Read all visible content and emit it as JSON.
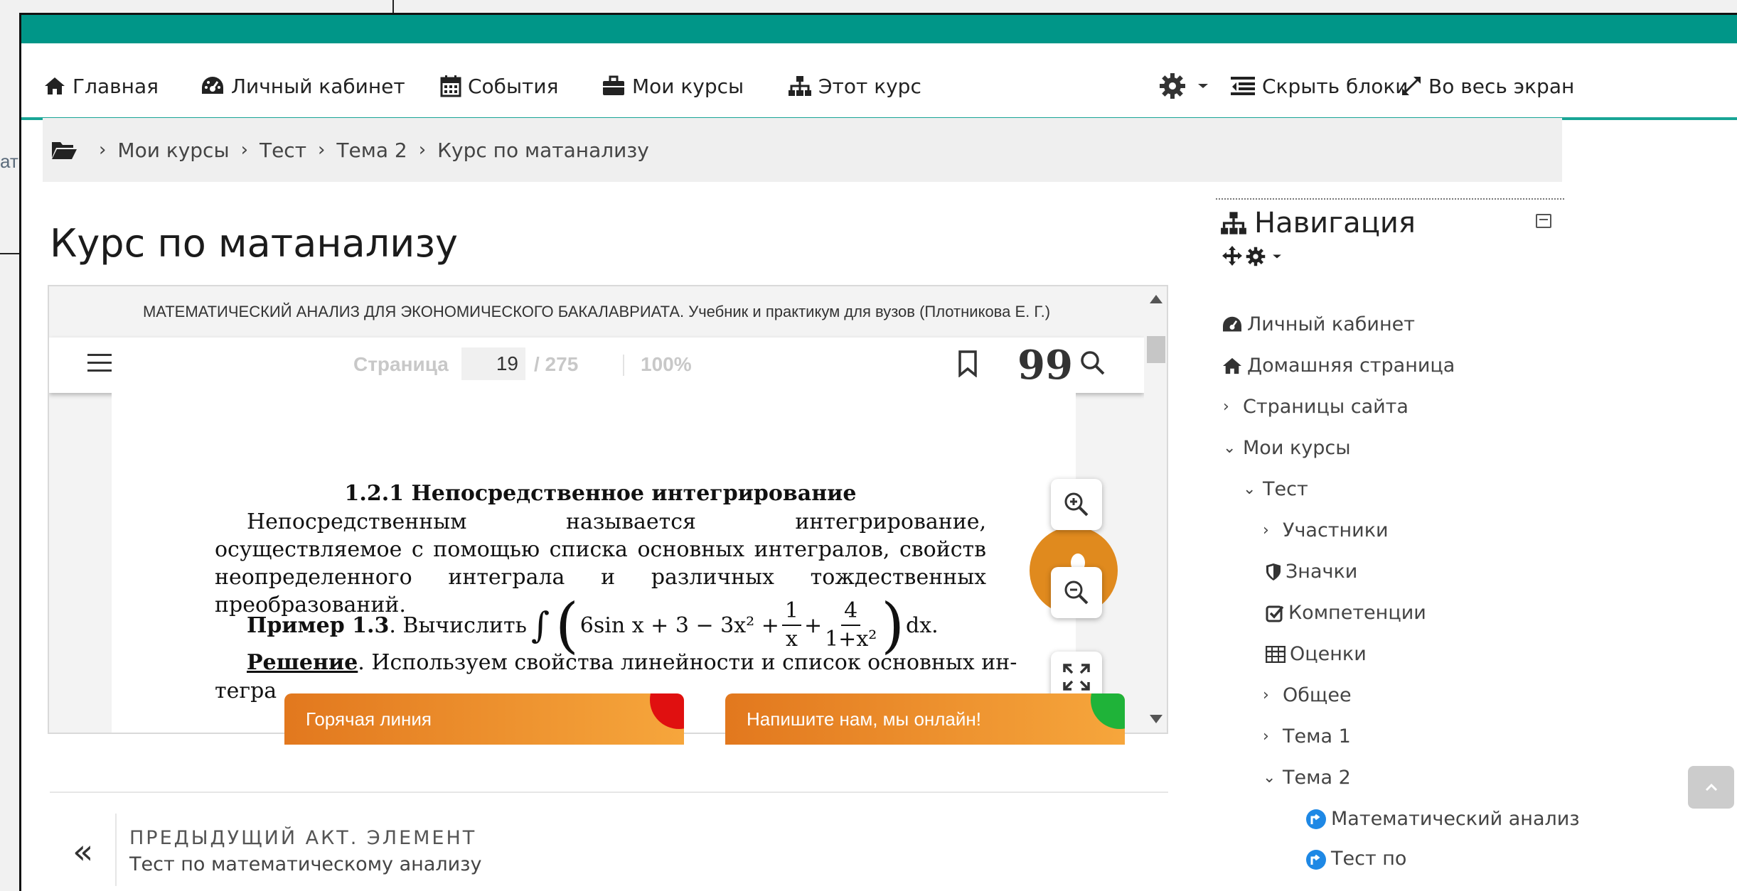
{
  "background": {
    "fragment_text": "ат"
  },
  "navbar": {
    "home": "Главная",
    "dashboard": "Личный кабинет",
    "events": "События",
    "my_courses": "Мои курсы",
    "this_course": "Этот курс",
    "hide_blocks": "Скрыть блоки",
    "fullscreen": "Во весь экран"
  },
  "breadcrumb": [
    "Мои курсы",
    "Тест",
    "Тема 2",
    "Курс по матанализу"
  ],
  "page_title": "Курс по матанализу",
  "reader": {
    "book_title": "МАТЕМАТИЧЕСКИЙ АНАЛИЗ ДЛЯ ЭКОНОМИЧЕСКОГО БАКАЛАВРИАТА. Учебник и практикум для вузов (Плотникова Е. Г.)",
    "page_label": "Страница",
    "page_current": "19",
    "page_total": "/ 275",
    "zoom": "100%",
    "quote_icon": "99",
    "content": {
      "heading": "1.2.1 Непосредственное интегрирование",
      "para1": "Непосредственным называется интегрирование, осуществляемое с помощью списка основных интегралов, свойств неопределенного интеграла и различных тождественных преобразований.",
      "example_label": "Пример 1.3",
      "example_text": ". Вычислить",
      "example_expr_a": "6sin x + 3 − 3x² +",
      "frac1_num": "1",
      "frac1_den": "x",
      "plus": "+",
      "frac2_num": "4",
      "frac2_den": "1+x²",
      "dx": "dx.",
      "solution_label": "Решение",
      "solution_text": ". Используем свойства линейности и список основных ин-",
      "solution_cont": "тегра"
    }
  },
  "chat": {
    "hotline": "Горячая линия",
    "online": "Напишите нам, мы онлайн!"
  },
  "prev_activity": {
    "arrow": "«",
    "label": "ПРЕДЫДУЩИЙ АКТ. ЭЛЕМЕНТ",
    "link": "Тест по математическому анализу"
  },
  "nav_block": {
    "title": "Навигация",
    "items": {
      "dashboard": "Личный кабинет",
      "home": "Домашняя страница",
      "site_pages": "Страницы сайта",
      "my_courses": "Мои курсы",
      "test": "Тест",
      "participants": "Участники",
      "badges": "Значки",
      "competencies": "Компетенции",
      "grades": "Оценки",
      "general": "Общее",
      "topic1": "Тема 1",
      "topic2": "Тема 2",
      "math_analysis": "Математический анализ",
      "test_math": "Тест по математическому анализу"
    },
    "caret_right": "›",
    "caret_down": "⌄"
  },
  "colors": {
    "teal": "#009688",
    "nav_border": "#19a596",
    "orange": "#e2781e",
    "red": "#e01010",
    "green": "#1fb339",
    "url_icon_blue": "#1e88e5"
  },
  "icons": [
    "home-icon",
    "dashboard-icon",
    "calendar-icon",
    "briefcase-icon",
    "sitemap-icon",
    "gear-icon",
    "hide-blocks-icon",
    "expand-icon",
    "folder-icon",
    "menu-icon",
    "bookmark-icon",
    "quote-icon",
    "search-icon",
    "zoom-in-icon",
    "zoom-out-icon",
    "fullscreen-icon",
    "move-icon",
    "shield-icon",
    "checkbox-icon",
    "table-icon",
    "url-icon",
    "chevron-up-icon"
  ]
}
